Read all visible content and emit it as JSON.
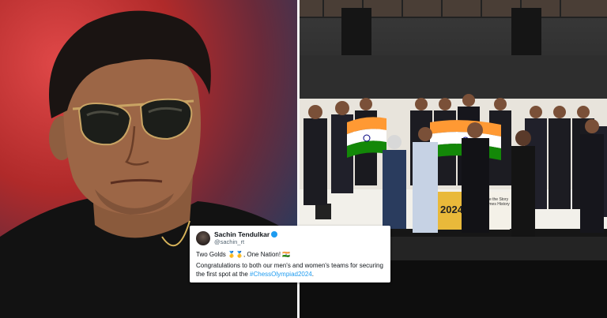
{
  "tweet": {
    "name": "Sachin Tendulkar",
    "handle": "@sachin_rt",
    "line1": "Two Golds 🥇🥇, One Nation! 🇮🇳",
    "body_text": "Congratulations to both our men's and women's teams for securing the first spot at the ",
    "hashtag": "#ChessOlympiad2024",
    "body_end": "."
  },
  "stage_sign": {
    "year": "2024",
    "tagline": "Where the Story Becomes History"
  },
  "colors": {
    "left_bg_red": "#b02a2a",
    "flag_saffron": "#ff9933",
    "flag_white": "#ffffff",
    "flag_green": "#138808",
    "hashtag_blue": "#1d9bf0"
  }
}
